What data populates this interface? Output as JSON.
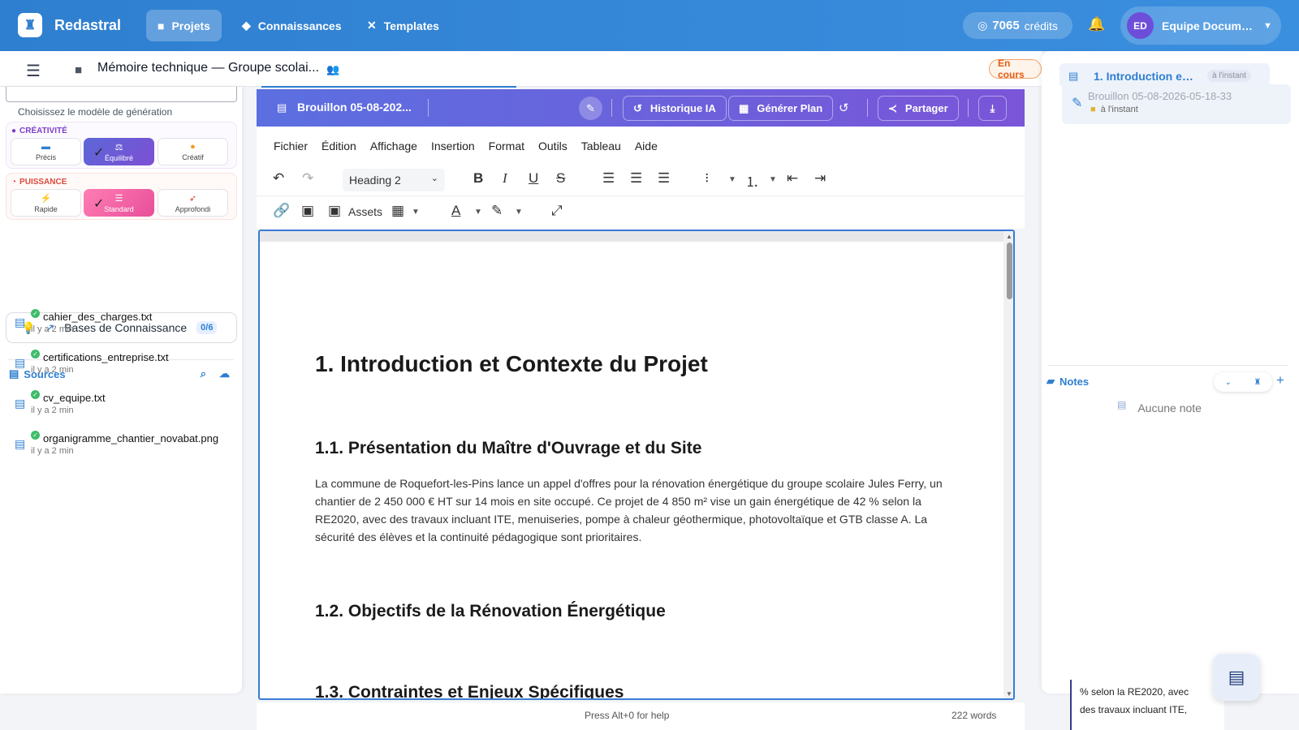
{
  "app": {
    "brand": "Redastral",
    "logo_icon": "robot-logo-icon"
  },
  "nav": {
    "tabs": [
      {
        "label": "Projets",
        "icon": "folder-icon",
        "active": true
      },
      {
        "label": "Connaissances",
        "icon": "graduation-cap-icon",
        "active": false
      },
      {
        "label": "Templates",
        "icon": "tools-icon",
        "active": false
      }
    ]
  },
  "credits": {
    "amount": "7065",
    "unit": "crédits"
  },
  "user": {
    "initials": "ED",
    "name": "Equipe Documen..."
  },
  "project": {
    "title": "Mémoire technique — Groupe scolai...",
    "status": "En cours"
  },
  "generation": {
    "model_hint": "Choisissez le modèle de génération",
    "creativity": {
      "title": "CRÉATIVITÉ",
      "options": [
        "Précis",
        "Équilibré",
        "Créatif"
      ],
      "selected": "Équilibré"
    },
    "power": {
      "title": "PUISSANCE",
      "options": [
        "Rapide",
        "Standard",
        "Approfondi"
      ],
      "selected": "Standard"
    }
  },
  "knowledge": {
    "label": "Bases de Connaissance",
    "count": "0/6"
  },
  "sources": {
    "title": "Sources",
    "items": [
      {
        "name": "cahier_des_charges.txt",
        "time": "il y a 2 min"
      },
      {
        "name": "certifications_entreprise.txt",
        "time": "il y a 2 min"
      },
      {
        "name": "cv_equipe.txt",
        "time": "il y a 2 min"
      },
      {
        "name": "organigramme_chantier_novabat.png",
        "time": "il y a 2 min"
      }
    ]
  },
  "editor": {
    "draft_name": "Brouillon 05-08-202...",
    "buttons": {
      "history": "Historique IA",
      "plan": "Générer Plan",
      "share": "Partager"
    },
    "menu": [
      "Fichier",
      "Édition",
      "Affichage",
      "Insertion",
      "Format",
      "Outils",
      "Tableau",
      "Aide"
    ],
    "block_format": "Heading 2",
    "assets_label": "Assets",
    "footer_help": "Press Alt+0 for help",
    "word_count": "222 words"
  },
  "document": {
    "h1": "1. Introduction et Contexte du Projet",
    "h2_1": "1.1. Présentation du Maître d'Ouvrage et du Site",
    "paragraph": "La commune de Roquefort-les-Pins lance un appel d'offres pour la rénovation énergétique du groupe scolaire Jules Ferry, un chantier de 2 450 000 € HT sur 14 mois en site occupé. Ce projet de 4 850 m² vise un gain énergétique de 42 % selon la RE2020, avec des travaux incluant ITE, menuiseries, pompe à chaleur géothermique, photovoltaïque et GTB classe A. La sécurité des élèves et la continuité pédagogique sont prioritaires.",
    "h2_2": "1.2. Objectifs de la Rénovation Énergétique",
    "h2_3": "1.3. Contraintes et Enjeux Spécifiques"
  },
  "right_panel": {
    "toc_item": {
      "label": "1. Introduction et ...",
      "time": "à l'instant"
    },
    "version_item": {
      "label": "Brouillon 05-08-2026-05-18-33",
      "time": "à l'instant"
    },
    "notes": {
      "title": "Notes",
      "empty": "Aucune note"
    },
    "peek_text": [
      "% selon la RE2020, avec",
      "des travaux incluant ITE,"
    ]
  },
  "colors": {
    "primary": "#2f7fd0",
    "header_gradient_start": "#5b6fe0",
    "header_gradient_end": "#7a55d8",
    "status_orange": "#e25d12",
    "selected_pink": "#e84e9a",
    "success_green": "#3ebc6a"
  }
}
